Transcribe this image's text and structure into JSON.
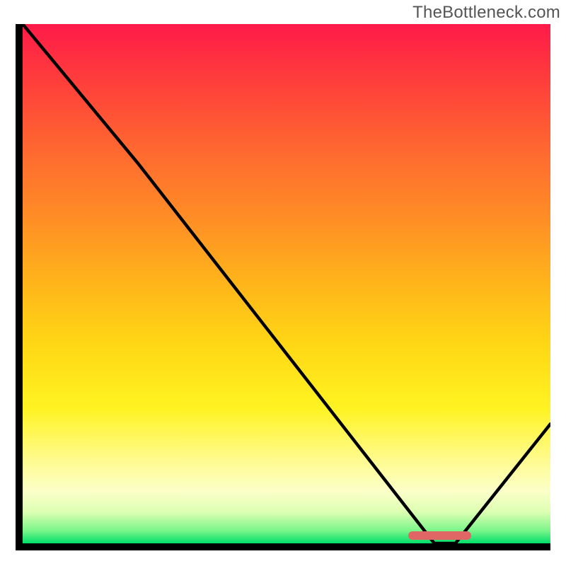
{
  "watermark": "TheBottleneck.com",
  "chart_data": {
    "type": "line",
    "title": "",
    "xlabel": "",
    "ylabel": "",
    "xlim": [
      0,
      100
    ],
    "ylim": [
      0,
      100
    ],
    "grid": false,
    "legend": false,
    "series": [
      {
        "name": "curve",
        "x": [
          0,
          22,
          78,
          82,
          100
        ],
        "y": [
          100,
          73,
          0,
          0,
          23
        ]
      }
    ],
    "optimum_marker": {
      "x_start": 73,
      "x_end": 85,
      "y": 1.5
    },
    "gradient_stops": [
      {
        "pct": 0,
        "color": "#ff1a49"
      },
      {
        "pct": 25,
        "color": "#ff6a2f"
      },
      {
        "pct": 50,
        "color": "#ffb51a"
      },
      {
        "pct": 75,
        "color": "#fff322"
      },
      {
        "pct": 94,
        "color": "#dcffb2"
      },
      {
        "pct": 100,
        "color": "#00e06a"
      }
    ]
  }
}
